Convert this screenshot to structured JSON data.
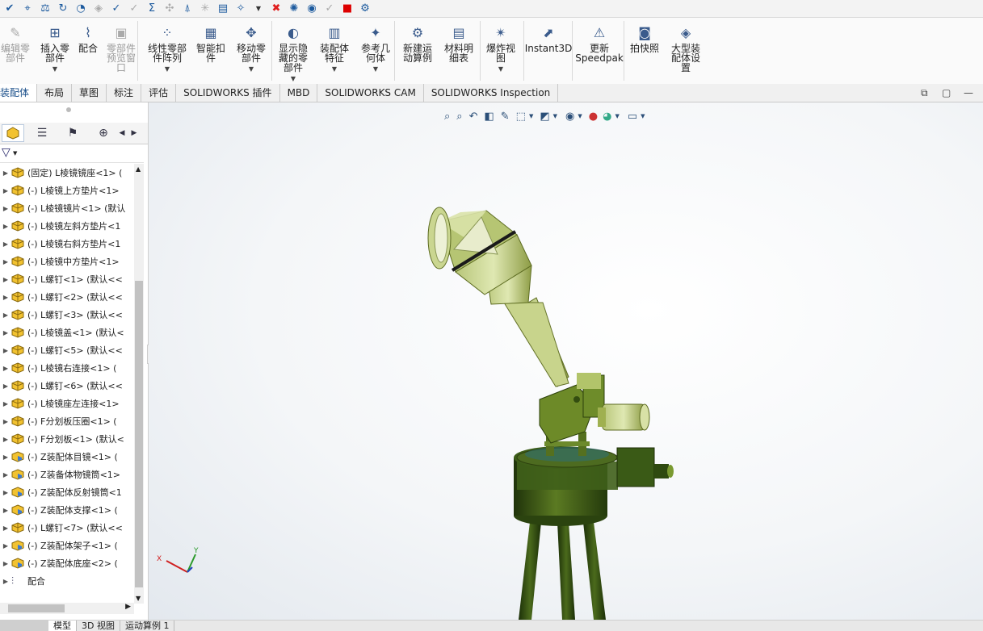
{
  "ribbon": {
    "buttons": [
      {
        "label": "编辑零部件",
        "lines": [
          "编辑零",
          "部件"
        ],
        "disabled": true,
        "icon": "edit-component-icon"
      },
      {
        "label": "插入零部件",
        "lines": [
          "插入零",
          "部件"
        ],
        "disabled": false,
        "icon": "insert-component-icon"
      },
      {
        "label": "配合",
        "lines": [
          "配合"
        ],
        "disabled": false,
        "icon": "mate-icon"
      },
      {
        "label": "零部件预览窗口",
        "lines": [
          "零部件",
          "预览窗",
          "口"
        ],
        "disabled": true,
        "icon": "component-preview-icon"
      },
      {
        "label": "线性零部件阵列",
        "lines": [
          "线性零部",
          "件阵列"
        ],
        "disabled": false,
        "icon": "linear-pattern-icon"
      },
      {
        "label": "智能扣件",
        "lines": [
          "智能扣",
          "件"
        ],
        "disabled": false,
        "icon": "smart-fastener-icon"
      },
      {
        "label": "移动零部件",
        "lines": [
          "移动零",
          "部件"
        ],
        "disabled": false,
        "icon": "move-component-icon"
      },
      {
        "label": "显示隐藏的零部件",
        "lines": [
          "显示隐",
          "藏的零",
          "部件"
        ],
        "disabled": false,
        "icon": "show-hidden-icon"
      },
      {
        "label": "装配体特征",
        "lines": [
          "装配体",
          "特征"
        ],
        "disabled": false,
        "icon": "assembly-feature-icon"
      },
      {
        "label": "参考几何体",
        "lines": [
          "参考几",
          "何体"
        ],
        "disabled": false,
        "icon": "reference-geometry-icon"
      },
      {
        "label": "新建运动算例",
        "lines": [
          "新建运",
          "动算例"
        ],
        "disabled": false,
        "icon": "motion-study-icon"
      },
      {
        "label": "材料明细表",
        "lines": [
          "材料明",
          "细表"
        ],
        "disabled": false,
        "icon": "bom-icon"
      },
      {
        "label": "爆炸视图",
        "lines": [
          "爆炸视",
          "图"
        ],
        "disabled": false,
        "icon": "exploded-view-icon"
      },
      {
        "label": "Instant3D",
        "lines": [
          "Instant3D"
        ],
        "disabled": false,
        "icon": "instant3d-icon"
      },
      {
        "label": "更新Speedpak",
        "lines": [
          "更新",
          "Speedpak"
        ],
        "disabled": false,
        "icon": "speedpak-icon"
      },
      {
        "label": "拍快照",
        "lines": [
          "拍快照"
        ],
        "disabled": false,
        "icon": "snapshot-icon"
      },
      {
        "label": "大型装配体设置",
        "lines": [
          "大型装",
          "配体设",
          "置"
        ],
        "disabled": false,
        "icon": "large-assembly-icon"
      }
    ]
  },
  "tabs": [
    "装配体",
    "布局",
    "草图",
    "标注",
    "评估",
    "SOLIDWORKS 插件",
    "MBD",
    "SOLIDWORKS CAM",
    "SOLIDWORKS Inspection"
  ],
  "tree": {
    "items": [
      "(固定) L棱镜镜座<1> (",
      "(-) L棱镜上方垫片<1>",
      "(-) L棱镜镜片<1> (默认",
      "(-) L棱镜左斜方垫片<1",
      "(-) L棱镜右斜方垫片<1",
      "(-) L棱镜中方垫片<1>",
      "(-) L螺钉<1> (默认<<",
      "(-) L螺钉<2> (默认<<",
      "(-) L螺钉<3> (默认<<",
      "(-) L棱镜盖<1> (默认<",
      "(-) L螺钉<5> (默认<<",
      "(-) L棱镜右连接<1> (",
      "(-) L螺钉<6> (默认<<",
      "(-) L棱镜座左连接<1>",
      "(-) F分划板压圈<1> (",
      "(-) F分划板<1> (默认<",
      "(-) Z装配体目镜<1> (",
      "(-) Z装备体物镜筒<1>",
      "(-) Z装配体反射镜筒<1",
      "(-) Z装配体支撑<1> (",
      "(-) L螺钉<7> (默认<<",
      "(-) Z装配体架子<1> (",
      "(-) Z装配体底座<2> ("
    ],
    "mates_label": "配合"
  },
  "bottom_tabs": [
    "模型",
    "3D 视图",
    "运动算例 1"
  ],
  "triad": {
    "x": "X",
    "y": "Y"
  },
  "colors": {
    "model_green": "#7a8f2a",
    "dark_green": "#2f4a12",
    "tab_active_text": "#1a4f8a"
  }
}
